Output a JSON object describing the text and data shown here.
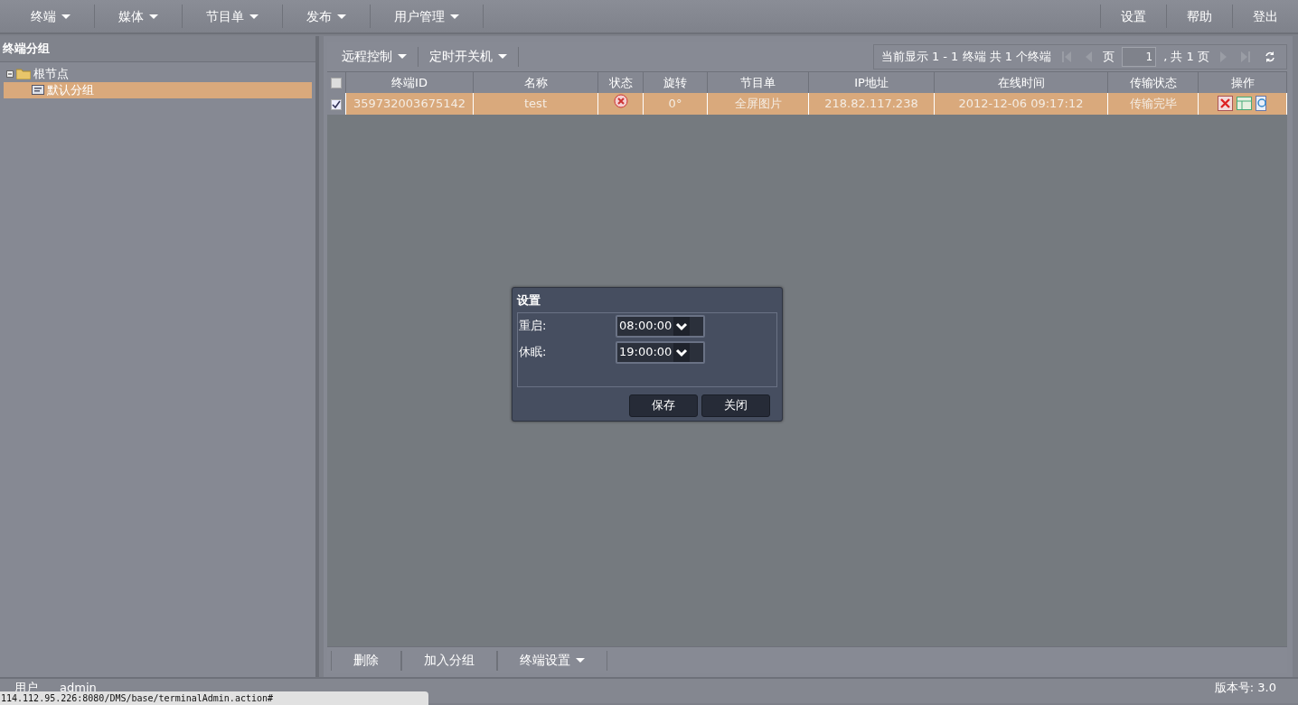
{
  "menu": {
    "left": [
      {
        "label": "终端",
        "dropdown": true
      },
      {
        "label": "媒体",
        "dropdown": true
      },
      {
        "label": "节目单",
        "dropdown": true
      },
      {
        "label": "发布",
        "dropdown": true
      },
      {
        "label": "用户管理",
        "dropdown": true
      }
    ],
    "right": [
      "设置",
      "帮助",
      "登出"
    ]
  },
  "sidebar": {
    "title": "终端分组",
    "tree": [
      {
        "label": "根节点",
        "expanded": true,
        "selected": false,
        "children": [
          {
            "label": "默认分组",
            "selected": true
          }
        ]
      }
    ]
  },
  "toolbar": {
    "menus": [
      {
        "label": "远程控制",
        "dropdown": true
      },
      {
        "label": "定时开关机",
        "dropdown": true
      }
    ],
    "pager": {
      "summary": "当前显示 1 - 1 终端 共 1 个终端",
      "page_label": "页",
      "page": "1",
      "total": ", 共 1 页"
    }
  },
  "table": {
    "all_checked": false,
    "columns": [
      "终端ID",
      "名称",
      "状态",
      "旋转",
      "节目单",
      "IP地址",
      "在线时间",
      "传输状态",
      "操作"
    ],
    "rows": [
      {
        "checked": true,
        "selected": true,
        "online": false,
        "id": "359732003675142",
        "name": "test",
        "rotation": "0°",
        "playlist": "全屏图片",
        "ip": "218.82.117.238",
        "online_time": "2012-12-06 09:17:12",
        "transfer": "传输完毕"
      }
    ]
  },
  "bottom_toolbar": [
    {
      "label": "删除",
      "dropdown": false
    },
    {
      "label": "加入分组",
      "dropdown": false
    },
    {
      "label": "终端设置",
      "dropdown": true
    }
  ],
  "dialog": {
    "title": "设置",
    "fields": [
      {
        "label": "重启:",
        "value": "08:00:00"
      },
      {
        "label": "休眠:",
        "value": "19:00:00"
      }
    ],
    "buttons": [
      "保存",
      "关闭"
    ]
  },
  "footer": {
    "user_label": "用户",
    "user": "admin",
    "version": "版本号: 3.0"
  },
  "url_bubble": "114.112.95.226:8080/DMS/base/terminalAdmin.action#"
}
